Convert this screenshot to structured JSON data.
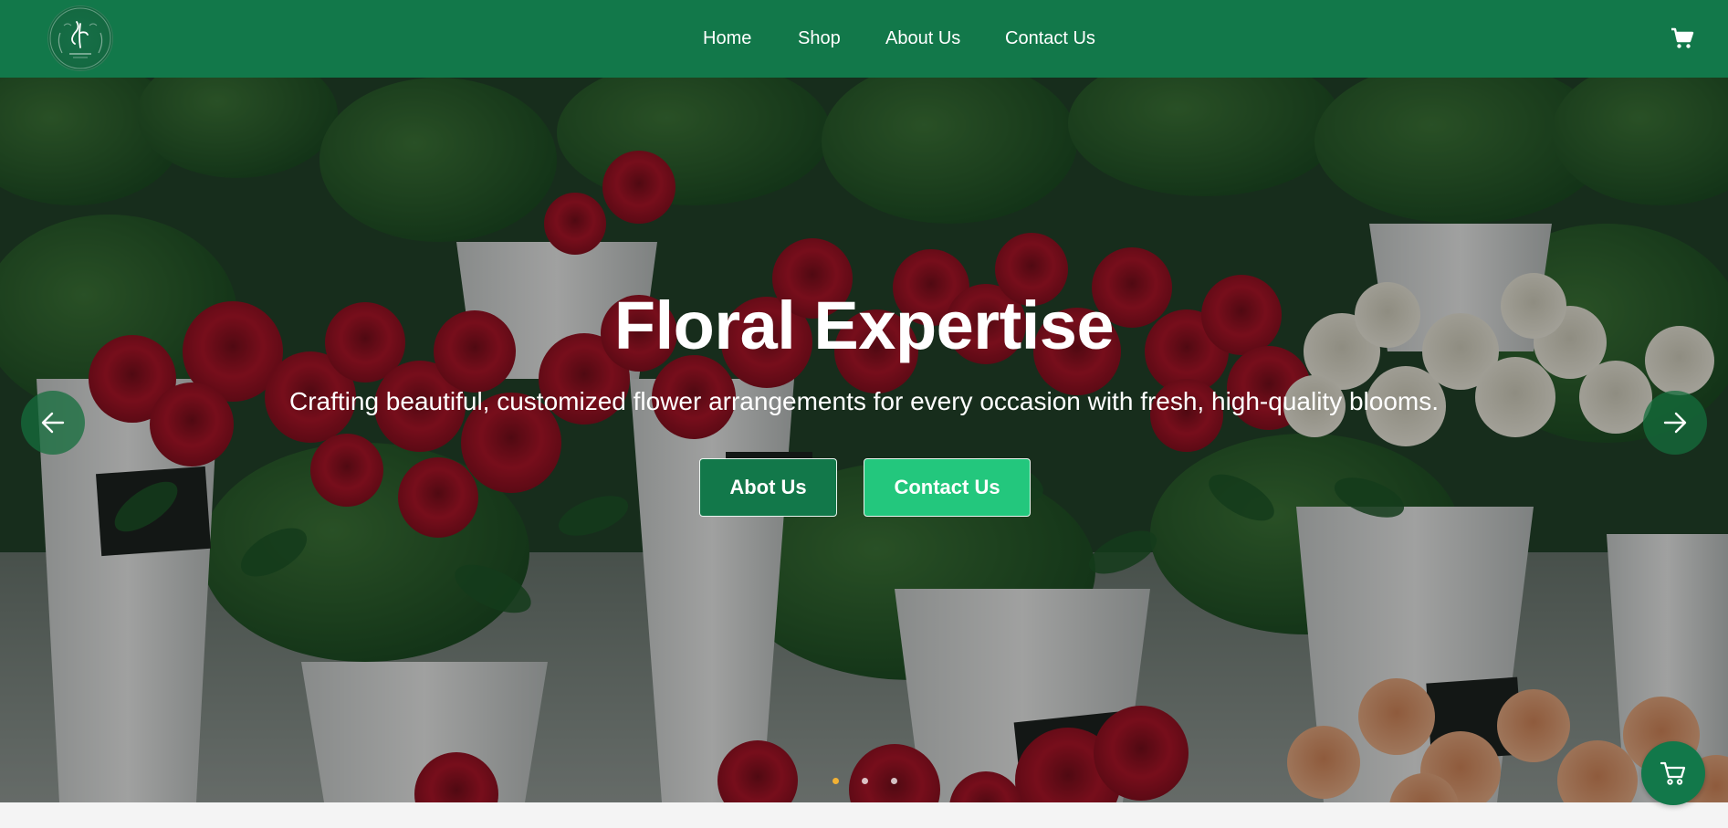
{
  "header": {
    "logo_icon": "sf-monogram-logo",
    "nav": {
      "home": "Home",
      "shop": "Shop",
      "about": "About Us",
      "contact": "Contact Us"
    },
    "cart_icon": "cart-icon"
  },
  "hero": {
    "title": "Floral Expertise",
    "subtitle": "Crafting beautiful, customized flower arrangements for every occasion with fresh, high-quality blooms.",
    "about_button": "Abot Us",
    "contact_button": "Contact Us",
    "prev_icon": "arrow-left-icon",
    "next_icon": "arrow-right-icon",
    "slides_count": 3,
    "active_slide": 1
  },
  "floating_cart_icon": "cart-icon",
  "colors": {
    "brand_green": "#12784a",
    "accent_green": "#23c77d",
    "active_dot": "#f2b134",
    "rose_red": "#b5162a"
  }
}
